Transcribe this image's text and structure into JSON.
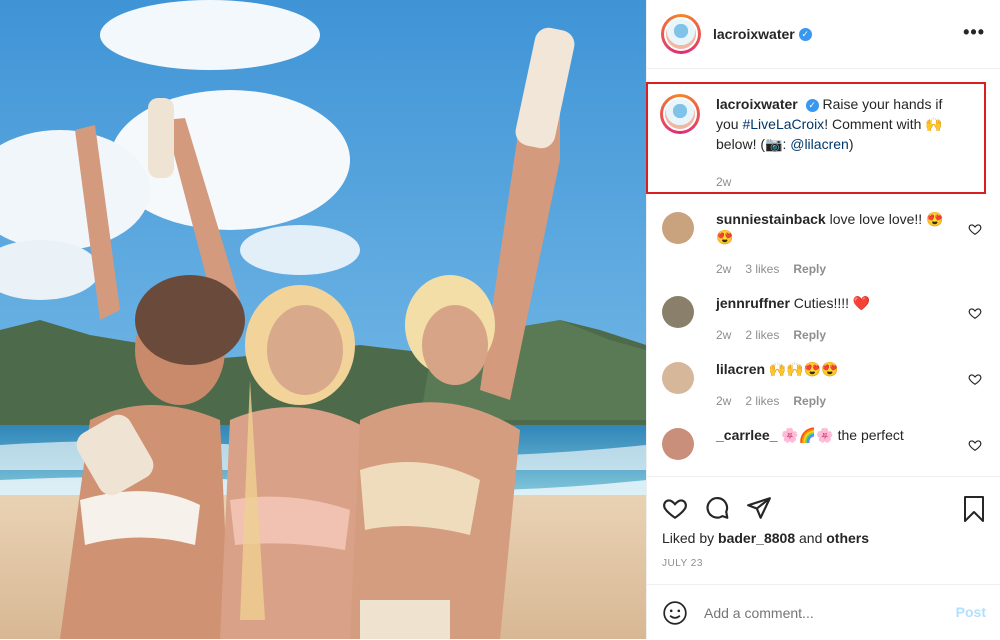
{
  "post": {
    "username": "lacroixwater",
    "verified_glyph": "✓",
    "more_glyph": "•••"
  },
  "caption": {
    "username": "lacroixwater",
    "text_a": "Raise your hands if you ",
    "hashtag": "#LiveLaCroix",
    "text_b": "! Comment with 🙌 below! (📷: ",
    "mention": "@lilacren",
    "text_c": ")",
    "time": "2w"
  },
  "comments": [
    {
      "username": "sunniestainback",
      "text": "love love love!! 😍😍",
      "time": "2w",
      "likes": "3 likes",
      "reply": "Reply",
      "avatar_color": "#c9a27e"
    },
    {
      "username": "jennruffner",
      "text": "Cuties!!!! ❤️",
      "time": "2w",
      "likes": "2 likes",
      "reply": "Reply",
      "avatar_color": "#8a7f6b"
    },
    {
      "username": "lilacren",
      "text": "🙌🙌😍😍",
      "time": "2w",
      "likes": "2 likes",
      "reply": "Reply",
      "avatar_color": "#d7b79a"
    },
    {
      "username": "_carrlee_",
      "text": "🌸🌈🌸 the perfect",
      "time": "",
      "likes": "",
      "reply": "",
      "avatar_color": "#c98f7a"
    }
  ],
  "likes": {
    "prefix": "Liked by ",
    "user": "bader_8808",
    "mid": " and ",
    "others": "others"
  },
  "date": "JULY 23",
  "add_comment": {
    "placeholder": "Add a comment...",
    "post_label": "Post"
  },
  "colors": {
    "highlight": "#d82020",
    "verified": "#3897f0",
    "heart": "#ed4956",
    "post_disabled": "#b2dffc"
  }
}
